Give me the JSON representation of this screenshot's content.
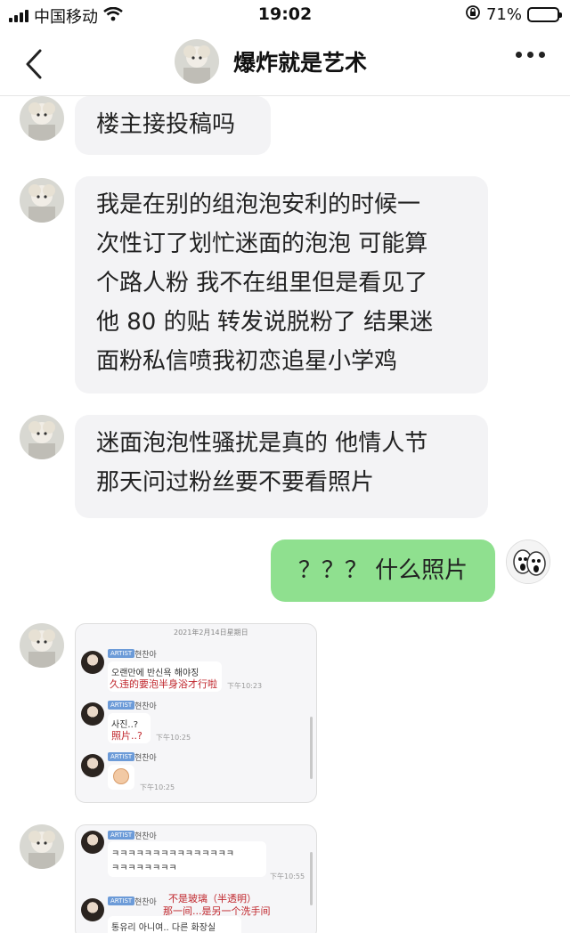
{
  "status_bar": {
    "carrier": "中国移动",
    "time": "19:02",
    "battery_percent": "71%",
    "battery_level": 0.71,
    "icons": [
      "signal-icon",
      "wifi-icon",
      "orientation-lock-icon",
      "battery-icon"
    ]
  },
  "nav": {
    "title": "爆炸就是艺术",
    "back_icon": "chevron-left-icon",
    "more_icon": "more-horizontal-icon"
  },
  "messages": [
    {
      "from": "other",
      "text": "楼主接投稿吗"
    },
    {
      "from": "other",
      "lines": [
        "我是在别的组泡泡安利的时候一",
        "次性订了划忙迷面的泡泡 可能算",
        "个路人粉 我不在组里但是看见了",
        "他 80 的贴 转发说脱粉了 结果迷",
        "面粉私信喷我初恋追星小学鸡"
      ]
    },
    {
      "from": "other",
      "lines": [
        "迷面泡泡性骚扰是真的 他情人节",
        "那天问过粉丝要不要看照片"
      ]
    },
    {
      "from": "me",
      "text": "？？？ 什么照片"
    }
  ],
  "screenshot_1": {
    "date": "2021年2月14日星期日",
    "tag": "ARTIST",
    "name": "현찬아",
    "msg1_kr": "오랜만에 반신욕 해야징",
    "msg1_cn": "久违的要泡半身浴才行啦",
    "msg1_time": "下午10:23",
    "msg2_kr": "사진..?",
    "msg2_cn": "照片..?",
    "msg2_time": "下午10:25",
    "msg3_time": "下午10:25"
  },
  "screenshot_2": {
    "tag": "ARTIST",
    "name": "현찬아",
    "msg1_line1": "ㅋㅋㅋㅋㅋㅋㅋㅋㅋㅋㅋㅋㅋㅋㅋ",
    "msg1_line2": "ㅋㅋㅋㅋㅋㅋㅋㅋ",
    "msg1_time": "下午10:55",
    "msg2_cn1": "不是玻璃（半透明）",
    "msg2_cn2": "那一间...是另一个洗手间",
    "msg2_kr": "통유리 아니여.. 다른 화장실"
  }
}
